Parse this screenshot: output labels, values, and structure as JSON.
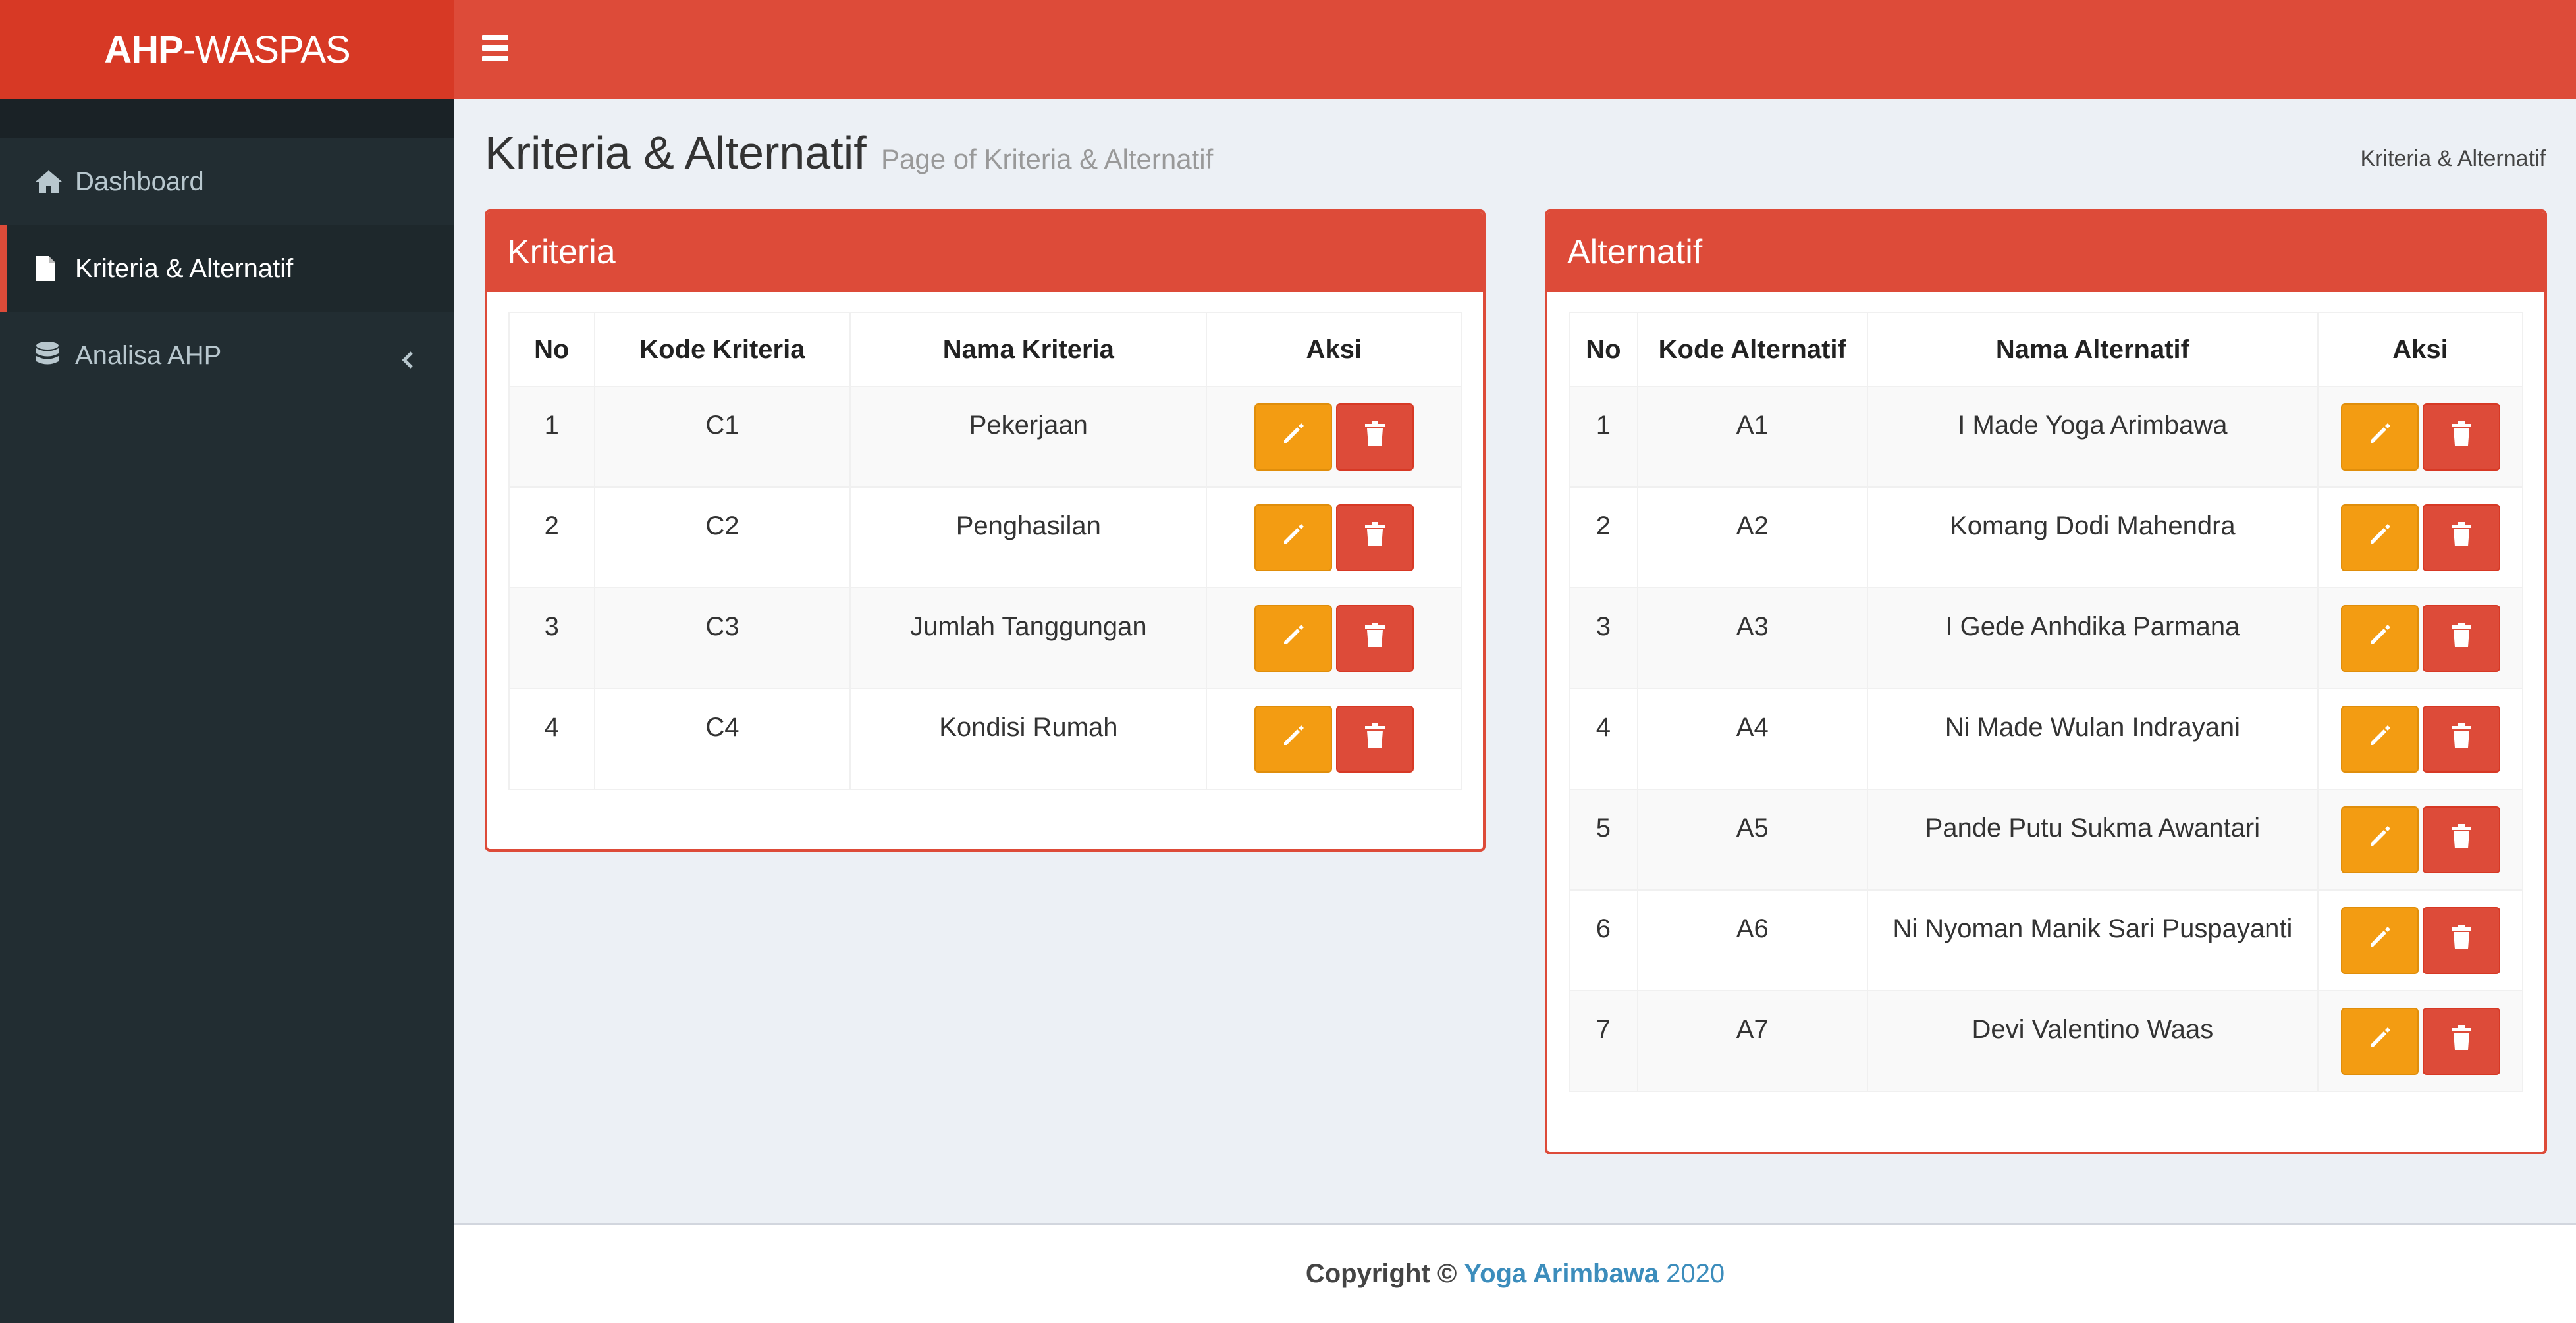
{
  "app": {
    "logo_bold": "AHP",
    "logo_rest": "-WASPAS"
  },
  "sidebar": {
    "items": [
      {
        "label": "Dashboard",
        "icon": "home-icon"
      },
      {
        "label": "Kriteria & Alternatif",
        "icon": "file-icon",
        "active": true
      },
      {
        "label": "Analisa AHP",
        "icon": "database-icon",
        "has_submenu": true
      }
    ]
  },
  "page": {
    "title": "Kriteria & Alternatif",
    "subtitle": "Page of Kriteria & Alternatif",
    "breadcrumb": "Kriteria & Alternatif"
  },
  "kriteria": {
    "title": "Kriteria",
    "columns": [
      "No",
      "Kode Kriteria",
      "Nama Kriteria",
      "Aksi"
    ],
    "rows": [
      {
        "no": "1",
        "kode": "C1",
        "nama": "Pekerjaan"
      },
      {
        "no": "2",
        "kode": "C2",
        "nama": "Penghasilan"
      },
      {
        "no": "3",
        "kode": "C3",
        "nama": "Jumlah Tanggungan"
      },
      {
        "no": "4",
        "kode": "C4",
        "nama": "Kondisi Rumah"
      }
    ]
  },
  "alternatif": {
    "title": "Alternatif",
    "columns": [
      "No",
      "Kode Alternatif",
      "Nama Alternatif",
      "Aksi"
    ],
    "rows": [
      {
        "no": "1",
        "kode": "A1",
        "nama": "I Made Yoga Arimbawa"
      },
      {
        "no": "2",
        "kode": "A2",
        "nama": "Komang Dodi Mahendra"
      },
      {
        "no": "3",
        "kode": "A3",
        "nama": "I Gede Anhdika Parmana"
      },
      {
        "no": "4",
        "kode": "A4",
        "nama": "Ni Made Wulan Indrayani"
      },
      {
        "no": "5",
        "kode": "A5",
        "nama": "Pande Putu Sukma Awantari"
      },
      {
        "no": "6",
        "kode": "A6",
        "nama": "Ni Nyoman Manik Sari Puspayanti"
      },
      {
        "no": "7",
        "kode": "A7",
        "nama": "Devi Valentino Waas"
      }
    ]
  },
  "footer": {
    "prefix": "Copyright ©",
    "author": "Yoga Arimbawa",
    "year": "2020"
  },
  "colors": {
    "header_red": "#dd4b39",
    "logo_red": "#d73925",
    "sidebar_dark": "#222d32",
    "edit_orange": "#f39c12",
    "link_blue": "#3c8dbc"
  }
}
